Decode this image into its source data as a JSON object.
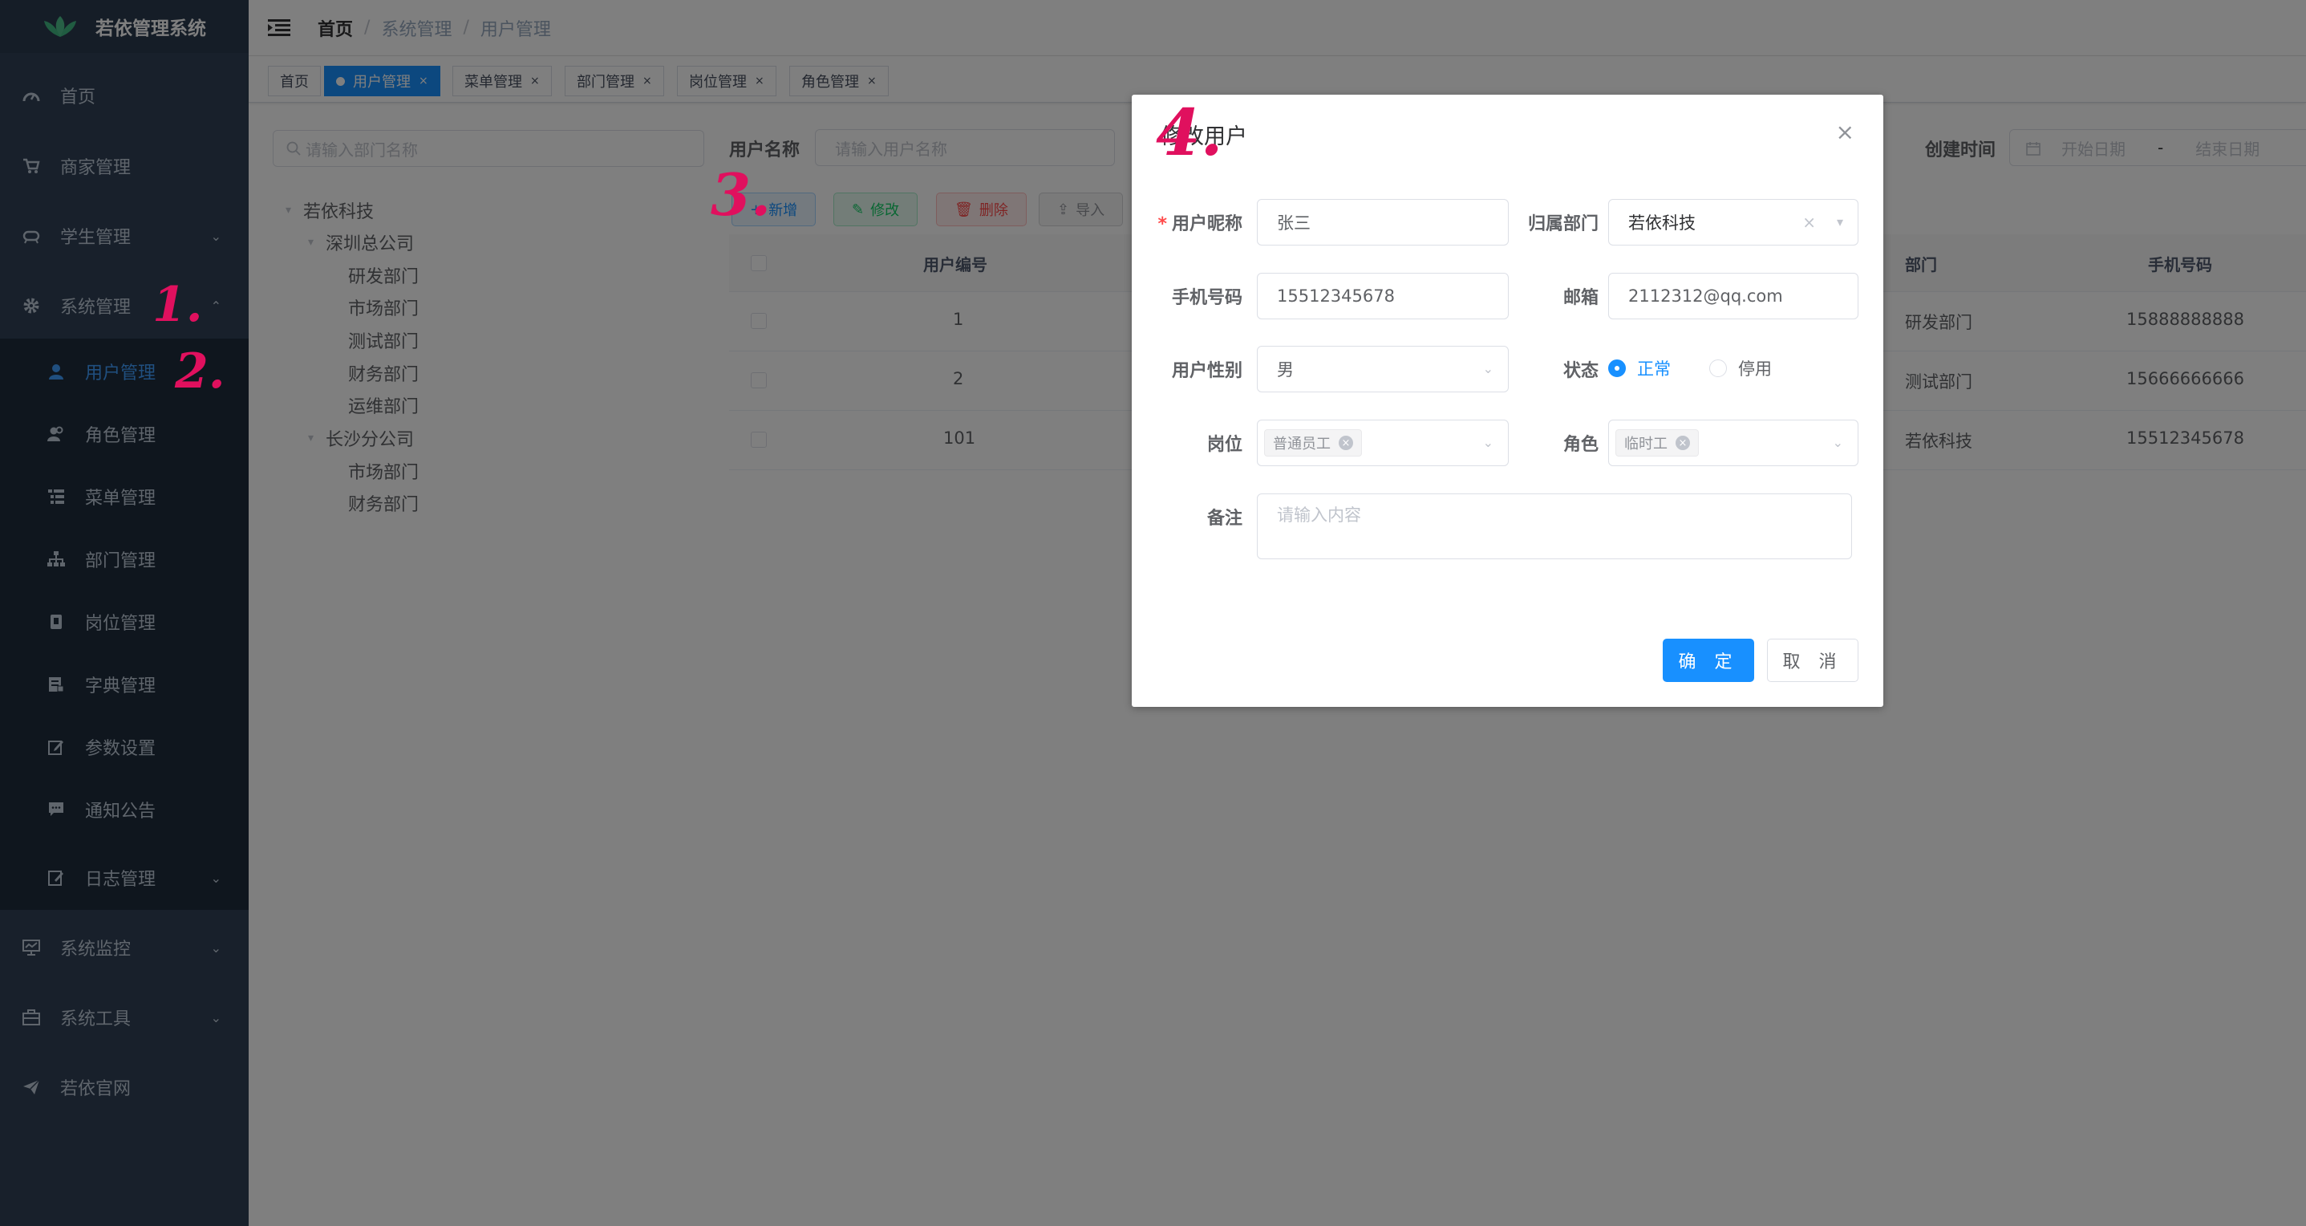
{
  "app": {
    "title": "若依管理系统"
  },
  "sidebar": {
    "items": [
      {
        "label": "首页",
        "icon": "dashboard-icon"
      },
      {
        "label": "商家管理",
        "icon": "shopping-cart-icon"
      },
      {
        "label": "学生管理",
        "icon": "education-icon",
        "arrow": "⌄"
      },
      {
        "label": "系统管理",
        "icon": "gear-icon",
        "arrow": "⌃"
      },
      {
        "label": "系统监控",
        "icon": "monitor-icon",
        "arrow": "⌄"
      },
      {
        "label": "系统工具",
        "icon": "toolbox-icon",
        "arrow": "⌄"
      },
      {
        "label": "若依官网",
        "icon": "paper-plane-icon"
      }
    ],
    "submenu": [
      {
        "label": "用户管理",
        "icon": "user-icon",
        "active": true
      },
      {
        "label": "角色管理",
        "icon": "peoples-icon"
      },
      {
        "label": "菜单管理",
        "icon": "tree-table-icon"
      },
      {
        "label": "部门管理",
        "icon": "tree-icon"
      },
      {
        "label": "岗位管理",
        "icon": "post-icon"
      },
      {
        "label": "字典管理",
        "icon": "dict-icon"
      },
      {
        "label": "参数设置",
        "icon": "edit-icon"
      },
      {
        "label": "通知公告",
        "icon": "message-icon"
      },
      {
        "label": "日志管理",
        "icon": "log-icon",
        "arrow": "⌄"
      }
    ]
  },
  "header": {
    "breadcrumb": [
      "首页",
      "系统管理",
      "用户管理"
    ],
    "separator": "/"
  },
  "tags": [
    {
      "label": "首页"
    },
    {
      "label": "用户管理",
      "active": true,
      "close": "×"
    },
    {
      "label": "菜单管理",
      "close": "×"
    },
    {
      "label": "部门管理",
      "close": "×"
    },
    {
      "label": "岗位管理",
      "close": "×"
    },
    {
      "label": "角色管理",
      "close": "×"
    }
  ],
  "dept_panel": {
    "search_placeholder": "请输入部门名称",
    "tree": [
      {
        "label": "若依科技"
      },
      {
        "label": "深圳总公司"
      },
      {
        "label": "研发部门"
      },
      {
        "label": "市场部门"
      },
      {
        "label": "测试部门"
      },
      {
        "label": "财务部门"
      },
      {
        "label": "运维部门"
      },
      {
        "label": "长沙分公司"
      },
      {
        "label": "市场部门"
      },
      {
        "label": "财务部门"
      }
    ]
  },
  "query": {
    "username_label": "用户名称",
    "username_placeholder": "请输入用户名称",
    "created_label": "创建时间",
    "start_placeholder": "开始日期",
    "range_sep": "-",
    "end_placeholder": "结束日期"
  },
  "toolbar": {
    "add": "新增",
    "edit": "修改",
    "delete": "删除",
    "import": "导入"
  },
  "table": {
    "columns": [
      "用户编号",
      "部门",
      "手机号码"
    ],
    "rows": [
      {
        "id": "1",
        "dept": "研发部门",
        "phone": "15888888888"
      },
      {
        "id": "2",
        "dept": "测试部门",
        "phone": "15666666666"
      },
      {
        "id": "101",
        "dept": "若依科技",
        "phone": "15512345678"
      }
    ]
  },
  "dialog": {
    "title": "修改用户",
    "close": "×",
    "fields": {
      "nickname_label": "用户昵称",
      "required_mark": "*",
      "nickname_value": "张三",
      "dept_label": "归属部门",
      "dept_value": "若依科技",
      "phone_label": "手机号码",
      "phone_value": "15512345678",
      "email_label": "邮箱",
      "email_value": "2112312@qq.com",
      "sex_label": "用户性别",
      "sex_value": "男",
      "status_label": "状态",
      "status_normal": "正常",
      "status_disabled": "停用",
      "post_label": "岗位",
      "post_chip": "普通员工",
      "role_label": "角色",
      "role_chip": "临时工",
      "remark_label": "备注",
      "remark_placeholder": "请输入内容"
    },
    "confirm": "确 定",
    "cancel": "取 消"
  },
  "annotations": [
    "1.",
    "2.",
    "3.",
    "4."
  ],
  "colors": {
    "sidebar_bg": "#304156",
    "submenu_bg": "#1f2d3d",
    "primary": "#1890ff",
    "annotation": "#e0105e",
    "active_tag": "#42b983"
  }
}
